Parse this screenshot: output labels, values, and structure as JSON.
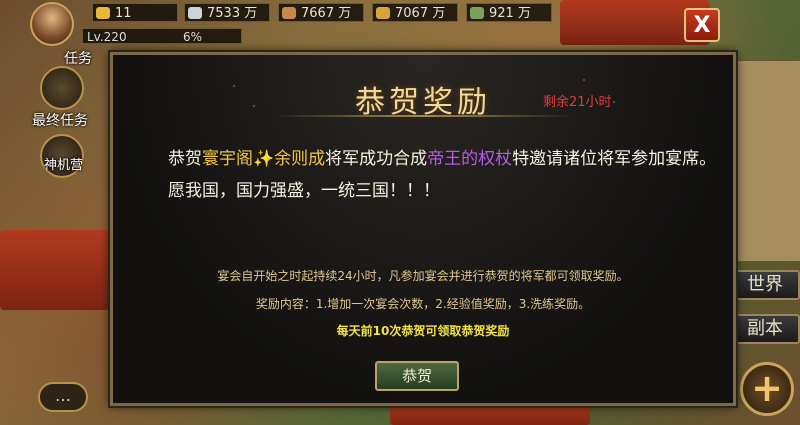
{
  "header": {
    "gold": "11",
    "silver": "7533 万",
    "food": "7667 万",
    "wood": "7067 万",
    "troops": "921 万",
    "level": "Lv.220",
    "exp_percent": "6%",
    "close_label": "X"
  },
  "side": {
    "task_label": "任务",
    "final_task_label": "最终任务",
    "shenji_label": "神机营"
  },
  "right": {
    "world_label": "世界",
    "copy_label": "副本",
    "plus_label": "+"
  },
  "chat": {
    "label": "…"
  },
  "modal": {
    "title": "恭贺奖励",
    "remaining": "剩余21小时",
    "msg_prefix": "恭贺",
    "player_name": "寰宇阁",
    "sparkle": "✨",
    "player_name2": "余则成",
    "msg_mid": "将军成功合成",
    "item_name": "帝王的权杖",
    "msg_suffix": "特邀请诸位将军参加宴席。",
    "msg_line2": "愿我国，国力强盛，一统三国！！！",
    "rule1": "宴会自开始之时起持续24小时，凡参加宴会并进行恭贺的将军都可领取奖励。",
    "rule2": "奖励内容：1.增加一次宴会次数，2.经验值奖励，3.洗练奖励。",
    "rule3": "每天前10次恭贺可领取恭贺奖励",
    "confirm_button": "恭贺"
  },
  "colors": {
    "title": "#f4d79a",
    "remaining": "#e23b3b",
    "player": "#f0c43c",
    "item": "#b55ae8",
    "rule_bright": "#f3e341"
  }
}
